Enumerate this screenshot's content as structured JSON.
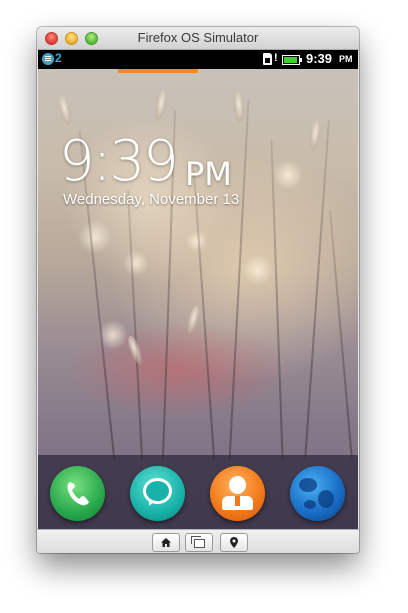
{
  "window": {
    "title": "Firefox OS Simulator"
  },
  "statusbar": {
    "notification_count": "2",
    "sim_alert": "!",
    "time": "9:39",
    "ampm": "PM",
    "battery_level": 0.9
  },
  "lockscreen": {
    "time": "9:39",
    "ampm": "PM",
    "date": "Wednesday, November 13"
  },
  "dock": {
    "apps": [
      {
        "name": "phone",
        "icon": "phone-icon"
      },
      {
        "name": "messages",
        "icon": "speech-bubble-icon"
      },
      {
        "name": "contacts",
        "icon": "person-icon"
      },
      {
        "name": "browser",
        "icon": "globe-icon"
      }
    ]
  },
  "toolbar": {
    "buttons": [
      {
        "name": "home",
        "icon": "home-icon"
      },
      {
        "name": "cards",
        "icon": "windows-icon"
      },
      {
        "name": "geolocation",
        "icon": "location-pin-icon"
      }
    ]
  },
  "colors": {
    "accent_orange": "#f08a24",
    "battery_green": "#3fd12f",
    "notification_blue": "#34a7d8"
  }
}
